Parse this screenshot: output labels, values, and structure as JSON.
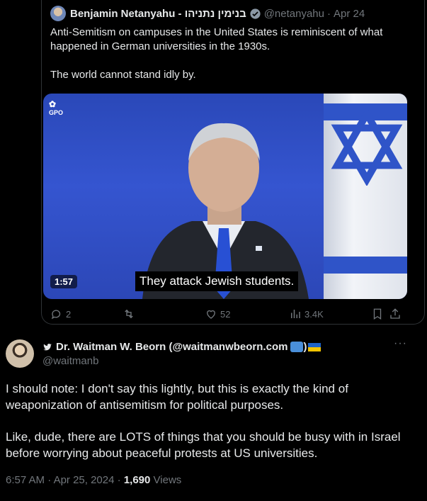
{
  "quoted_tweet": {
    "author_name": "Benjamin Netanyahu - בנימין נתניהו",
    "handle": "@netanyahu",
    "date": "Apr 24",
    "separator": "·",
    "text_paragraphs": [
      "Anti-Semitism on campuses in the United States is reminiscent of what happened in German universities in the 1930s.",
      "The world cannot stand idly by."
    ],
    "video": {
      "subtitle": "They attack Jewish students.",
      "duration": "1:57",
      "watermark": "GPO"
    },
    "stats": {
      "replies": "2",
      "retweets": "",
      "likes": "52",
      "views": "3.4K"
    },
    "icons": [
      "reply-icon",
      "retweet-icon",
      "like-icon",
      "views-icon",
      "bookmark-icon",
      "share-icon"
    ]
  },
  "reply_tweet": {
    "author_name": "Dr. Waitman W. Beorn (@waitmanwbeorn.com",
    "author_suffix": ")",
    "handle": "@waitmanb",
    "more": "···",
    "text_paragraphs": [
      "I should note: I don't say this lightly, but this is exactly the kind of weaponization of antisemitism for political purposes.",
      "Like, dude, there are LOTS of things that you should be busy with in Israel before worrying about peaceful protests at US universities."
    ],
    "time": "6:57 AM",
    "date": "Apr 25, 2024",
    "separator": "·",
    "views_count": "1,690",
    "views_label": "Views"
  },
  "colors": {
    "background": "#000000",
    "text": "#e7e9ea",
    "muted": "#71767b",
    "border": "#2f3336",
    "verified": "#1d9bf0"
  }
}
